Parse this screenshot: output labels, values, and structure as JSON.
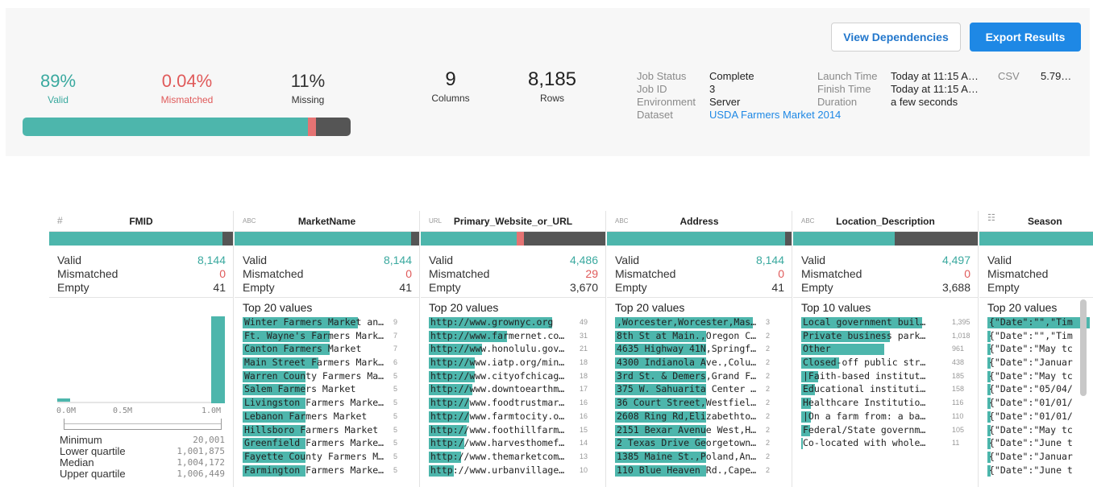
{
  "actions": {
    "view_dependencies": "View Dependencies",
    "export_results": "Export Results"
  },
  "summary": {
    "valid": {
      "value": "89%",
      "label": "Valid"
    },
    "mismatched": {
      "value": "0.04%",
      "label": "Mismatched"
    },
    "missing": {
      "value": "11%",
      "label": "Missing"
    },
    "columns": {
      "value": "9",
      "label": "Columns"
    },
    "rows": {
      "value": "8,185",
      "label": "Rows"
    },
    "quality_fractions": {
      "valid": 0.87,
      "mismatched": 0.025,
      "missing": 0.105
    },
    "colors": {
      "valid": "#4db6ac",
      "mismatched": "#e57373",
      "missing": "#555555"
    }
  },
  "job": {
    "status_label": "Job Status",
    "status": "Complete",
    "id_label": "Job ID",
    "id": "3",
    "environment_label": "Environment",
    "environment": "Server",
    "dataset_label": "Dataset",
    "dataset": "USDA Farmers Market 2014",
    "launch_label": "Launch Time",
    "launch": "Today at 11:15 A…",
    "finish_label": "Finish Time",
    "finish": "Today at 11:15 A…",
    "duration_label": "Duration",
    "duration": "a few seconds",
    "format_label": "CSV",
    "format_size": "5.79…"
  },
  "columns": [
    {
      "type": "#",
      "name": "FMID",
      "valid_label": "Valid",
      "valid": "8,144",
      "mismatched_label": "Mismatched",
      "mismatched": "0",
      "empty_label": "Empty",
      "empty": "41",
      "fractions": {
        "valid": 0.945,
        "mismatched": 0,
        "missing": 0.055
      },
      "axis": [
        "0.0M",
        "0.5M",
        "1.0M"
      ],
      "stats": [
        {
          "label": "Minimum",
          "value": "20,001"
        },
        {
          "label": "Lower quartile",
          "value": "1,001,875"
        },
        {
          "label": "Median",
          "value": "1,004,172"
        },
        {
          "label": "Upper quartile",
          "value": "1,006,449"
        }
      ]
    },
    {
      "type": "ABC",
      "name": "MarketName",
      "valid_label": "Valid",
      "valid": "8,144",
      "mismatched_label": "Mismatched",
      "mismatched": "0",
      "empty_label": "Empty",
      "empty": "41",
      "fractions": {
        "valid": 0.955,
        "mismatched": 0,
        "missing": 0.045
      },
      "top_title": "Top 20 values",
      "values": [
        {
          "text": "Winter Farmers Market an…",
          "count": "9",
          "fill": 0.82
        },
        {
          "text": "Ft. Wayne's Farmers Mark…",
          "count": "7",
          "fill": 0.62
        },
        {
          "text": "Canton Farmers Market",
          "count": "7",
          "fill": 0.62
        },
        {
          "text": "Main Street Farmers Mark…",
          "count": "6",
          "fill": 0.54
        },
        {
          "text": "Warren County Farmers Ma…",
          "count": "5",
          "fill": 0.45
        },
        {
          "text": "Salem Farmers Market",
          "count": "5",
          "fill": 0.45
        },
        {
          "text": "Livingston Farmers Marke…",
          "count": "5",
          "fill": 0.45
        },
        {
          "text": "Lebanon Farmers Market",
          "count": "5",
          "fill": 0.45
        },
        {
          "text": "Hillsboro Farmers Market",
          "count": "5",
          "fill": 0.45
        },
        {
          "text": "Greenfield Farmers Marke…",
          "count": "5",
          "fill": 0.45
        },
        {
          "text": "Fayette County Farmers M…",
          "count": "5",
          "fill": 0.45
        },
        {
          "text": "Farmington Farmers Marke…",
          "count": "5",
          "fill": 0.45
        }
      ]
    },
    {
      "type": "URL",
      "name": "Primary_Website_or_URL",
      "valid_label": "Valid",
      "valid": "4,486",
      "mismatched_label": "Mismatched",
      "mismatched": "29",
      "empty_label": "Empty",
      "empty": "3,670",
      "fractions": {
        "valid": 0.52,
        "mismatched": 0.04,
        "missing": 0.44
      },
      "top_title": "Top 20 values",
      "values": [
        {
          "text": "http://www.grownyc.org",
          "count": "49",
          "fill": 0.88
        },
        {
          "text": "http://www.farmernet.co…",
          "count": "31",
          "fill": 0.56
        },
        {
          "text": "http://www.honolulu.gov…",
          "count": "21",
          "fill": 0.38
        },
        {
          "text": "http://www.iatp.org/min…",
          "count": "18",
          "fill": 0.33
        },
        {
          "text": "http://www.cityofchicag…",
          "count": "18",
          "fill": 0.33
        },
        {
          "text": "http://www.downtoearthm…",
          "count": "17",
          "fill": 0.31
        },
        {
          "text": "http://www.foodtrustmar…",
          "count": "16",
          "fill": 0.29
        },
        {
          "text": "http://www.farmtocity.o…",
          "count": "16",
          "fill": 0.29
        },
        {
          "text": "http://www.foothillfarm…",
          "count": "15",
          "fill": 0.27
        },
        {
          "text": "http://www.harvesthomef…",
          "count": "14",
          "fill": 0.25
        },
        {
          "text": "http://www.themarketcom…",
          "count": "13",
          "fill": 0.23
        },
        {
          "text": "http://www.urbanvillage…",
          "count": "10",
          "fill": 0.18
        }
      ]
    },
    {
      "type": "ABC",
      "name": "Address",
      "valid_label": "Valid",
      "valid": "8,144",
      "mismatched_label": "Mismatched",
      "mismatched": "0",
      "empty_label": "Empty",
      "empty": "41",
      "fractions": {
        "valid": 0.965,
        "mismatched": 0,
        "missing": 0.035
      },
      "top_title": "Top 20 values",
      "values": [
        {
          "text": ",Worcester,Worcester,Mas…",
          "count": "3",
          "fill": 0.98
        },
        {
          "text": "8th St at Main.,Oregon C…",
          "count": "2",
          "fill": 0.65
        },
        {
          "text": "4635 Highway 41N,Springf…",
          "count": "2",
          "fill": 0.65
        },
        {
          "text": "4300 Indianola Ave.,Colu…",
          "count": "2",
          "fill": 0.65
        },
        {
          "text": "3rd St. & Demers,Grand F…",
          "count": "2",
          "fill": 0.65
        },
        {
          "text": "375 W. Sahuarita Center …",
          "count": "2",
          "fill": 0.65
        },
        {
          "text": "36 Court Street,Westfiel…",
          "count": "2",
          "fill": 0.65
        },
        {
          "text": "2608 Ring Rd,Elizabethto…",
          "count": "2",
          "fill": 0.65
        },
        {
          "text": "2151 Bexar Avenue West,H…",
          "count": "2",
          "fill": 0.65
        },
        {
          "text": "2 Texas Drive Georgetown…",
          "count": "2",
          "fill": 0.65
        },
        {
          "text": "1385 Maine St.,Poland,An…",
          "count": "2",
          "fill": 0.65
        },
        {
          "text": "110 Blue Heaven Rd.,Cape…",
          "count": "2",
          "fill": 0.65
        }
      ]
    },
    {
      "type": "ABC",
      "name": "Location_Description",
      "valid_label": "Valid",
      "valid": "4,497",
      "mismatched_label": "Mismatched",
      "mismatched": "0",
      "empty_label": "Empty",
      "empty": "3,688",
      "fractions": {
        "valid": 0.55,
        "mismatched": 0,
        "missing": 0.45
      },
      "top_title": "Top 10 values",
      "values": [
        {
          "text": "Local government buil…",
          "count": "1,395",
          "fill": 0.86
        },
        {
          "text": "Private business park…",
          "count": "1,018",
          "fill": 0.63
        },
        {
          "text": "Other",
          "count": "961",
          "fill": 0.59
        },
        {
          "text": "Closed-off public str…",
          "count": "438",
          "fill": 0.27
        },
        {
          "text": "|Faith-based institut…",
          "count": "185",
          "fill": 0.12
        },
        {
          "text": "Educational instituti…",
          "count": "158",
          "fill": 0.1
        },
        {
          "text": "Healthcare Institutio…",
          "count": "116",
          "fill": 0.07
        },
        {
          "text": "|On a farm from: a ba…",
          "count": "110",
          "fill": 0.07
        },
        {
          "text": "Federal/State governm…",
          "count": "105",
          "fill": 0.065
        },
        {
          "text": "Co-located with whole…",
          "count": "11",
          "fill": 0.01
        }
      ]
    },
    {
      "type": "grid",
      "name": "Season",
      "valid_label": "Valid",
      "valid": "",
      "mismatched_label": "Mismatched",
      "mismatched": "",
      "empty_label": "Empty",
      "empty": "",
      "fractions": {
        "valid": 1,
        "mismatched": 0,
        "missing": 0
      },
      "top_title": "Top 20 values",
      "values": [
        {
          "text": "{\"Date\":\"\",\"Tim",
          "count": "",
          "fill": 1
        },
        {
          "text": "{\"Date\":\"\",\"Tim",
          "count": "",
          "fill": 0.03
        },
        {
          "text": "{\"Date\":\"May tc",
          "count": "",
          "fill": 0.03
        },
        {
          "text": "{\"Date\":\"Januar",
          "count": "",
          "fill": 0.03
        },
        {
          "text": "{\"Date\":\"May tc",
          "count": "",
          "fill": 0.03
        },
        {
          "text": "{\"Date\":\"05/04/",
          "count": "",
          "fill": 0.03
        },
        {
          "text": "{\"Date\":\"01/01/",
          "count": "",
          "fill": 0.03
        },
        {
          "text": "{\"Date\":\"01/01/",
          "count": "",
          "fill": 0.03
        },
        {
          "text": "{\"Date\":\"May tc",
          "count": "",
          "fill": 0.03
        },
        {
          "text": "{\"Date\":\"June t",
          "count": "",
          "fill": 0.03
        },
        {
          "text": "{\"Date\":\"Januar",
          "count": "",
          "fill": 0.03
        },
        {
          "text": "{\"Date\":\"June t",
          "count": "",
          "fill": 0.03
        }
      ]
    }
  ]
}
